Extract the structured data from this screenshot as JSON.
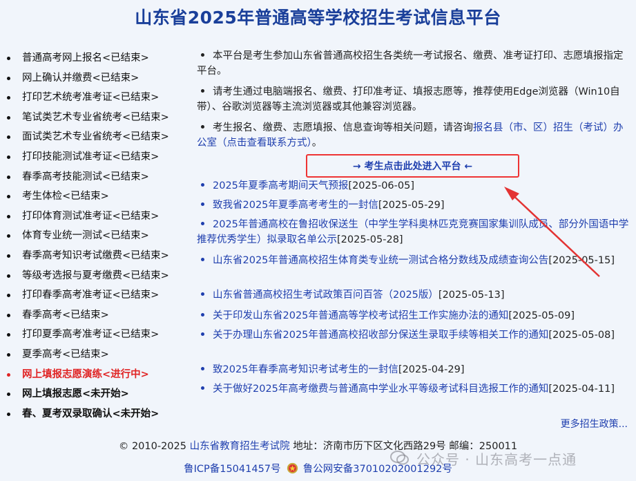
{
  "header": {
    "title": "山东省2025年普通高等学校招生考试信息平台"
  },
  "left_menu": [
    {
      "label": "普通高考网上报名<已结束>",
      "state": "normal"
    },
    {
      "label": "网上确认并缴费<已结束>",
      "state": "normal"
    },
    {
      "label": "打印艺术统考准考证<已结束>",
      "state": "normal"
    },
    {
      "label": "笔试类艺术专业省统考<已结束>",
      "state": "normal"
    },
    {
      "label": "面试类艺术专业省统考<已结束>",
      "state": "normal"
    },
    {
      "label": "打印技能测试准考证<已结束>",
      "state": "normal"
    },
    {
      "label": "春季高考技能测试<已结束>",
      "state": "normal"
    },
    {
      "label": "考生体检<已结束>",
      "state": "normal"
    },
    {
      "label": "打印体育测试准考证<已结束>",
      "state": "normal"
    },
    {
      "label": "体育专业统一测试<已结束>",
      "state": "normal"
    },
    {
      "label": "春季高考知识考试缴费<已结束>",
      "state": "normal"
    },
    {
      "label": "等级考选报与夏考缴费<已结束>",
      "state": "normal"
    },
    {
      "label": "打印春季高考准考证<已结束>",
      "state": "normal"
    },
    {
      "label": "春季高考<已结束>",
      "state": "normal"
    },
    {
      "label": "打印夏季高考准考证<已结束>",
      "state": "normal"
    },
    {
      "label": "夏季高考<已结束>",
      "state": "normal"
    },
    {
      "label": "网上填报志愿演练<进行中>",
      "state": "active"
    },
    {
      "label": "网上填报志愿<未开始>",
      "state": "bold"
    },
    {
      "label": "春、夏考双录取确认<未开始>",
      "state": "bold"
    }
  ],
  "notices": {
    "n1": "本平台是考生参加山东省普通高校招生各类统一考试报名、缴费、准考证打印、志愿填报指定平台。",
    "n2": "请考生通过电脑端报名、缴费、打印准考证、填报志愿等，推荐使用Edge浏览器（Win10自带）、谷歌浏览器等主流浏览器或其他兼容浏览器。",
    "n3_text": "考生报名、缴费、志愿填报、信息查询等相关问题，请咨询",
    "n3_link": "报名县（市、区）招生（考试）办公室（点击查看联系方式）",
    "n3_end": "。"
  },
  "enter_button": "→ 考生点击此处进入平台 ←",
  "news": [
    {
      "title": "2025年夏季高考期间天气预报",
      "date": "[2025-06-05]"
    },
    {
      "title": "致我省2025年夏季高考考生的一封信",
      "date": "[2025-05-29]"
    },
    {
      "title": "2025年普通高校在鲁招收保送生（中学生学科奥林匹克竞赛国家集训队成员、部分外国语中学推荐优秀学生）拟录取名单公示",
      "date": "[2025-05-28]"
    },
    {
      "title": "山东省2025年普通高校招生体育类专业统一测试合格分数线及成绩查询公告",
      "date": "[2025-05-15]"
    },
    {
      "title": "山东省普通高校招生考试政策百问百答（2025版）",
      "date": "[2025-05-13]"
    },
    {
      "title": "关于印发山东省2025年普通高等学校考试招生工作实施办法的通知",
      "date": "[2025-05-09]"
    },
    {
      "title": "关于办理山东省2025年普通高校招收部分保送生录取手续等相关工作的通知",
      "date": "[2025-05-08]"
    },
    {
      "title": "致2025年春季高考知识考试考生的一封信",
      "date": "[2025-04-29]"
    },
    {
      "title": "关于做好2025年高考缴费与普通高中学业水平等级考试科目选报工作的通知",
      "date": "[2025-04-11]"
    }
  ],
  "more_link": "更多招生政策...",
  "footer": {
    "copyright": "© 2010-2025",
    "org_link": "山东省教育招生考试院",
    "address": "地址：济南市历下区文化西路29号 邮编：250011",
    "icp": "鲁ICP备15041457号",
    "police": "鲁公网安备37010202001292号"
  },
  "watermark": "公众号 · 山东高考一点通",
  "colors": {
    "title": "#1a3f9a",
    "link": "#1f3fae",
    "active": "#e02424",
    "annotation": "#e33333"
  }
}
